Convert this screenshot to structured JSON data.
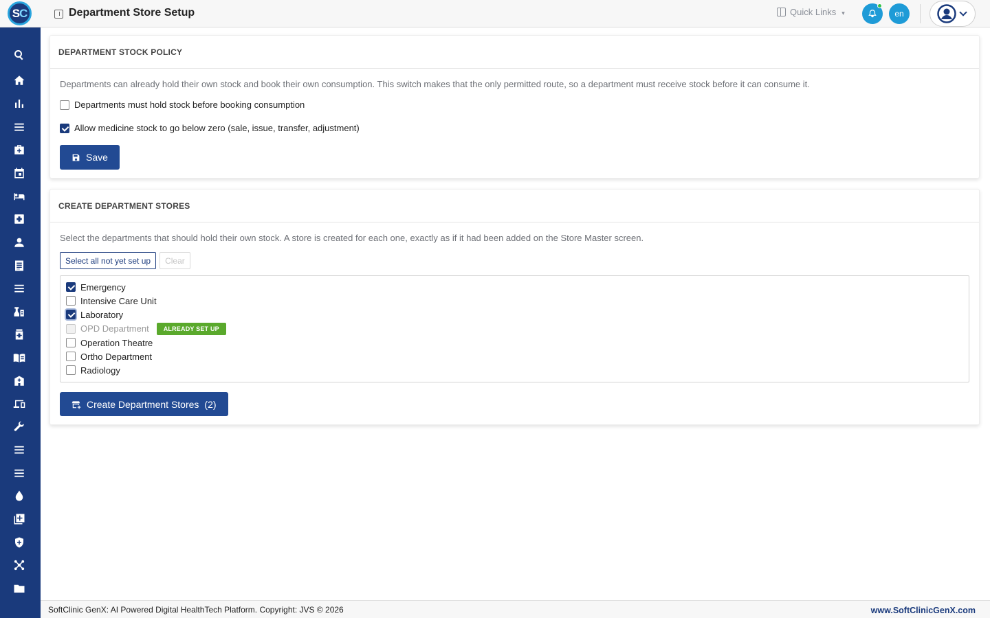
{
  "header": {
    "logo_letter_1": "S",
    "logo_letter_2": "C",
    "title": "Department Store Setup",
    "quick_links": "Quick Links",
    "language": "en"
  },
  "sidebar": {
    "icons": [
      "search-icon",
      "home-icon",
      "bar-chart-icon",
      "menu-lines-icon",
      "medical-bag-icon",
      "calendar-icon",
      "bed-icon",
      "medical-cross-icon",
      "person-icon",
      "document-icon",
      "menu-lines-icon",
      "lab-icon",
      "pharmacy-icon",
      "book-icon",
      "building-icon",
      "devices-icon",
      "wrench-icon",
      "menu-lines-icon",
      "menu-lines-icon",
      "drop-icon",
      "add-library-icon",
      "shield-icon",
      "network-icon",
      "folder-icon"
    ]
  },
  "policy": {
    "heading": "DEPARTMENT STOCK POLICY",
    "description": "Departments can already hold their own stock and book their own consumption. This switch makes that the only permitted route, so a department must receive stock before it can consume it.",
    "option_hold_stock": {
      "label": "Departments must hold stock before booking consumption",
      "checked": false
    },
    "option_below_zero": {
      "label": "Allow medicine stock to go below zero (sale, issue, transfer, adjustment)",
      "checked": true
    },
    "save_label": "Save"
  },
  "stores": {
    "heading": "CREATE DEPARTMENT STORES",
    "description": "Select the departments that should hold their own stock. A store is created for each one, exactly as if it had been added on the Store Master screen.",
    "select_all_label": "Select all not yet set up",
    "clear_label": "Clear",
    "departments": [
      {
        "name": "Emergency",
        "checked": true
      },
      {
        "name": "Intensive Care Unit",
        "checked": false
      },
      {
        "name": "Laboratory",
        "checked": true
      },
      {
        "name": "OPD Department",
        "checked": false,
        "disabled": true,
        "badge": "ALREADY SET UP"
      },
      {
        "name": "Operation Theatre",
        "checked": false
      },
      {
        "name": "Ortho Department",
        "checked": false
      },
      {
        "name": "Radiology",
        "checked": false
      }
    ],
    "create_label": "Create Department Stores",
    "create_count": "(2)"
  },
  "footer": {
    "left": "SoftClinic GenX: AI Powered Digital HealthTech Platform. Copyright: JVS © 2026",
    "right": "www.SoftClinicGenX.com"
  }
}
